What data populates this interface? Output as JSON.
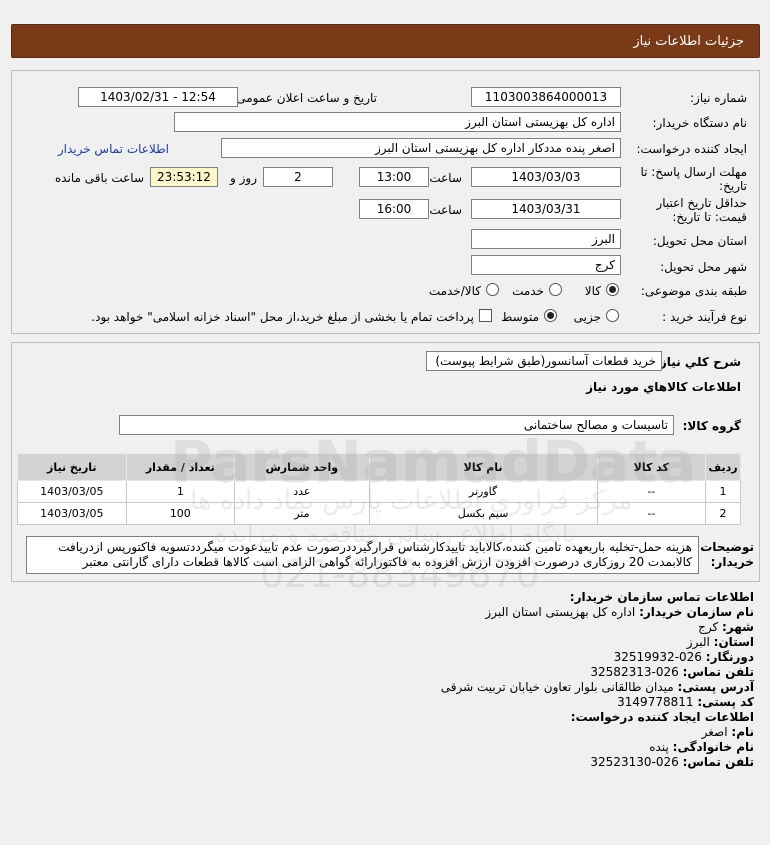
{
  "header": {
    "title": "جزئیات اطلاعات نیاز"
  },
  "form": {
    "need_number_label": "شماره نیاز:",
    "need_number": "1103003864000013",
    "announce_label": "تاریخ و ساعت اعلان عمومی:",
    "announce_value": "1403/02/31 - 12:54",
    "buyer_label": "نام دستگاه خریدار:",
    "buyer_value": "اداره کل بهزیستی استان البرز",
    "creator_label": "ایجاد کننده درخواست:",
    "creator_value": "اصغر پنده مددکار اداره کل بهزیستی استان البرز",
    "contact_link": "اطلاعات تماس خریدار",
    "deadline_label": "مهلت ارسال پاسخ: تا تاریخ:",
    "deadline_date": "1403/03/03",
    "time_label": "ساعت",
    "deadline_time": "13:00",
    "days_value": "2",
    "days_label": "روز و",
    "remaining_value": "23:53:12",
    "remaining_label": "ساعت باقی مانده",
    "validity_label": "حداقل تاریخ اعتبار قیمت: تا تاریخ:",
    "validity_date": "1403/03/31",
    "validity_time": "16:00",
    "province_label": "استان محل تحویل:",
    "province_value": "البرز",
    "city_label": "شهر محل تحویل:",
    "city_value": "کرج",
    "category_label": "طبقه بندی موضوعی:",
    "category_options": [
      "کالا",
      "خدمت",
      "کالا/خدمت"
    ],
    "category_selected": "کالا",
    "process_label": "نوع فرآیند خرید :",
    "process_options": [
      "جزیی",
      "متوسط"
    ],
    "process_selected": "متوسط",
    "payment_note": "پرداخت تمام یا بخشی از مبلغ خرید،از محل \"اسناد خزانه اسلامی\" خواهد بود."
  },
  "description": {
    "label": "شرح کلي نياز:",
    "value": "خرید قطعات آسانسور(طبق شرایط پیوست)",
    "items_heading": "اطلاعات كالاهاي مورد نياز",
    "group_label": "گروه کالا:",
    "group_value": "تاسیسات و مصالح ساختمانی"
  },
  "table": {
    "headers": [
      "ردیف",
      "کد کالا",
      "نام کالا",
      "واحد شمارش",
      "تعداد / مقدار",
      "تاریخ نیاز"
    ],
    "rows": [
      [
        "1",
        "--",
        "گاورنر",
        "عدد",
        "1",
        "1403/03/05"
      ],
      [
        "2",
        "--",
        "سیم بکسل",
        "متر",
        "100",
        "1403/03/05"
      ]
    ]
  },
  "notes": {
    "label": "توضیحات خریدار:",
    "line1": "هزینه حمل-تخلیه باربعهده تامین کننده،کالاباید تاییدکارشناس قرارگیرددرصورت عدم تاییدعودت میگرددتسویه فاکتورپس ازدریافت",
    "line2": "کالابمدت 20 روزکاری درصورت افزودن ارزش افزوده به فاکتورارائه گواهی الزامی است کالاها قطعات دارای گارانتی معتبر"
  },
  "contact": {
    "heading": "اطلاعات تماس سازمان خریدار:",
    "org_label": "نام سازمان خریدار:",
    "org_value": "اداره کل بهزیستی استان البرز",
    "city_label": "شهر:",
    "city_value": "کرج",
    "province_label": "استان:",
    "province_value": "البرز",
    "fax_label": "دورنگار:",
    "fax_value": "026-32519932",
    "phone_label": "تلفن تماس:",
    "phone_value": "026-32582313",
    "address_label": "آدرس پستی:",
    "address_value": "میدان طالقانی بلوار تعاون خیابان تربیت شرقی",
    "postal_label": "کد پستی:",
    "postal_value": "3149778811",
    "creator_heading": "اطلاعات ایجاد کننده درخواست:",
    "name_label": "نام:",
    "name_value": "اصغر",
    "family_label": "نام خانوادگی:",
    "family_value": "پنده",
    "creator_phone_label": "تلفن تماس:",
    "creator_phone_value": "026-32523130"
  },
  "watermark": {
    "line1": "ParsNamadData",
    "line2": "مرکز فراوری اطلاعات پارس نماد داده ها",
    "line3": "پایگاه اطلاع رسانی مناقصه و مزایده",
    "line4": "021-88349670"
  }
}
